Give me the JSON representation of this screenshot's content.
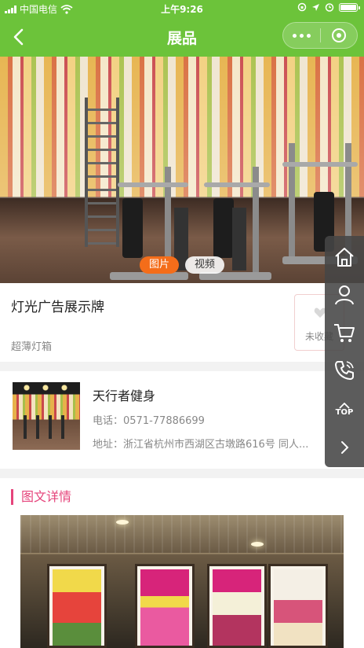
{
  "status_bar": {
    "carrier": "中国电信",
    "time": "上午9:26"
  },
  "nav": {
    "title": "展品"
  },
  "media_tabs": [
    {
      "label": "图片",
      "active": true
    },
    {
      "label": "视频",
      "active": false
    }
  ],
  "product": {
    "name": "灯光广告展示牌",
    "subtitle": "超薄灯箱",
    "favorite_label": "未收藏"
  },
  "store": {
    "name": "天行者健身",
    "phone": "电话：0571-77886699",
    "address": "地址：浙江省杭州市西湖区古墩路616号 同人..."
  },
  "detail": {
    "heading": "图文详情"
  },
  "sidebar": {
    "top_label": "TOP"
  },
  "colors": {
    "brand_green": "#6cc33a",
    "accent_orange": "#f46d1a",
    "section_pink": "#e5447b"
  },
  "icons": [
    "signal-icon",
    "wifi-icon",
    "back-icon",
    "more-icon",
    "close-mini-program-icon",
    "heart-icon",
    "home-icon",
    "user-icon",
    "cart-icon",
    "phone-icon",
    "top-icon",
    "chevron-right-icon"
  ]
}
